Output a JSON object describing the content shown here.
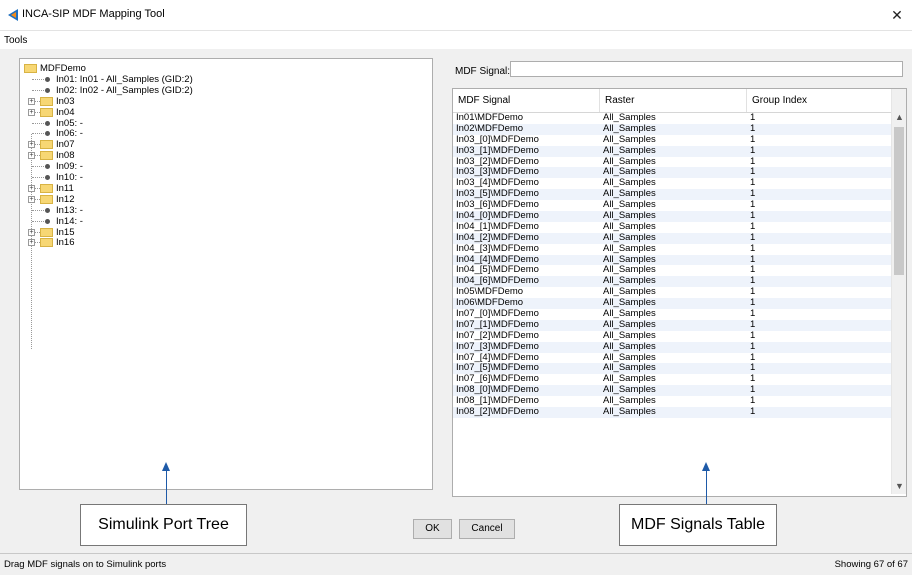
{
  "window": {
    "title": "INCA-SIP MDF Mapping Tool",
    "close_glyph": "✕"
  },
  "menu": {
    "tools": "Tools"
  },
  "tree": {
    "root": "MDFDemo",
    "nodes": [
      {
        "label": "In01: In01 - All_Samples (GID:2)",
        "kind": "leaf"
      },
      {
        "label": "In02: In02 - All_Samples (GID:2)",
        "kind": "leaf"
      },
      {
        "label": "In03",
        "kind": "folder"
      },
      {
        "label": "In04",
        "kind": "folder"
      },
      {
        "label": "In05: -",
        "kind": "leaf"
      },
      {
        "label": "In06: -",
        "kind": "leaf"
      },
      {
        "label": "In07",
        "kind": "folder"
      },
      {
        "label": "In08",
        "kind": "folder"
      },
      {
        "label": "In09: -",
        "kind": "leaf"
      },
      {
        "label": "In10: -",
        "kind": "leaf"
      },
      {
        "label": "In11",
        "kind": "folder"
      },
      {
        "label": "In12",
        "kind": "folder"
      },
      {
        "label": "In13: -",
        "kind": "leaf"
      },
      {
        "label": "In14: -",
        "kind": "leaf"
      },
      {
        "label": "In15",
        "kind": "folder"
      },
      {
        "label": "In16",
        "kind": "folder"
      }
    ],
    "expander_glyph": "+"
  },
  "mdf_signal": {
    "label": "MDF Signal:",
    "value": ""
  },
  "table": {
    "columns": [
      "MDF Signal",
      "Raster",
      "Group Index"
    ],
    "rows": [
      [
        "In01\\MDFDemo",
        "All_Samples",
        "1"
      ],
      [
        "In02\\MDFDemo",
        "All_Samples",
        "1"
      ],
      [
        "In03_[0]\\MDFDemo",
        "All_Samples",
        "1"
      ],
      [
        "In03_[1]\\MDFDemo",
        "All_Samples",
        "1"
      ],
      [
        "In03_[2]\\MDFDemo",
        "All_Samples",
        "1"
      ],
      [
        "In03_[3]\\MDFDemo",
        "All_Samples",
        "1"
      ],
      [
        "In03_[4]\\MDFDemo",
        "All_Samples",
        "1"
      ],
      [
        "In03_[5]\\MDFDemo",
        "All_Samples",
        "1"
      ],
      [
        "In03_[6]\\MDFDemo",
        "All_Samples",
        "1"
      ],
      [
        "In04_[0]\\MDFDemo",
        "All_Samples",
        "1"
      ],
      [
        "In04_[1]\\MDFDemo",
        "All_Samples",
        "1"
      ],
      [
        "In04_[2]\\MDFDemo",
        "All_Samples",
        "1"
      ],
      [
        "In04_[3]\\MDFDemo",
        "All_Samples",
        "1"
      ],
      [
        "In04_[4]\\MDFDemo",
        "All_Samples",
        "1"
      ],
      [
        "In04_[5]\\MDFDemo",
        "All_Samples",
        "1"
      ],
      [
        "In04_[6]\\MDFDemo",
        "All_Samples",
        "1"
      ],
      [
        "In05\\MDFDemo",
        "All_Samples",
        "1"
      ],
      [
        "In06\\MDFDemo",
        "All_Samples",
        "1"
      ],
      [
        "In07_[0]\\MDFDemo",
        "All_Samples",
        "1"
      ],
      [
        "In07_[1]\\MDFDemo",
        "All_Samples",
        "1"
      ],
      [
        "In07_[2]\\MDFDemo",
        "All_Samples",
        "1"
      ],
      [
        "In07_[3]\\MDFDemo",
        "All_Samples",
        "1"
      ],
      [
        "In07_[4]\\MDFDemo",
        "All_Samples",
        "1"
      ],
      [
        "In07_[5]\\MDFDemo",
        "All_Samples",
        "1"
      ],
      [
        "In07_[6]\\MDFDemo",
        "All_Samples",
        "1"
      ],
      [
        "In08_[0]\\MDFDemo",
        "All_Samples",
        "1"
      ],
      [
        "In08_[1]\\MDFDemo",
        "All_Samples",
        "1"
      ],
      [
        "In08_[2]\\MDFDemo",
        "All_Samples",
        "1"
      ]
    ],
    "scroll_up_glyph": "▲",
    "scroll_down_glyph": "▼"
  },
  "callouts": {
    "left": "Simulink Port Tree",
    "right": "MDF Signals Table"
  },
  "buttons": {
    "ok": "OK",
    "cancel": "Cancel"
  },
  "status": {
    "left": "Drag MDF signals on to Simulink ports",
    "right": "Showing 67 of 67"
  },
  "colors": {
    "accent": "#1e5aa8",
    "folder": "#f7d774",
    "row_alt": "#eef3fb"
  },
  "icons": {
    "app": "inca-logo-icon",
    "close": "close-icon",
    "folder": "folder-icon",
    "leaf": "signal-dot-icon",
    "expander": "expand-icon"
  }
}
